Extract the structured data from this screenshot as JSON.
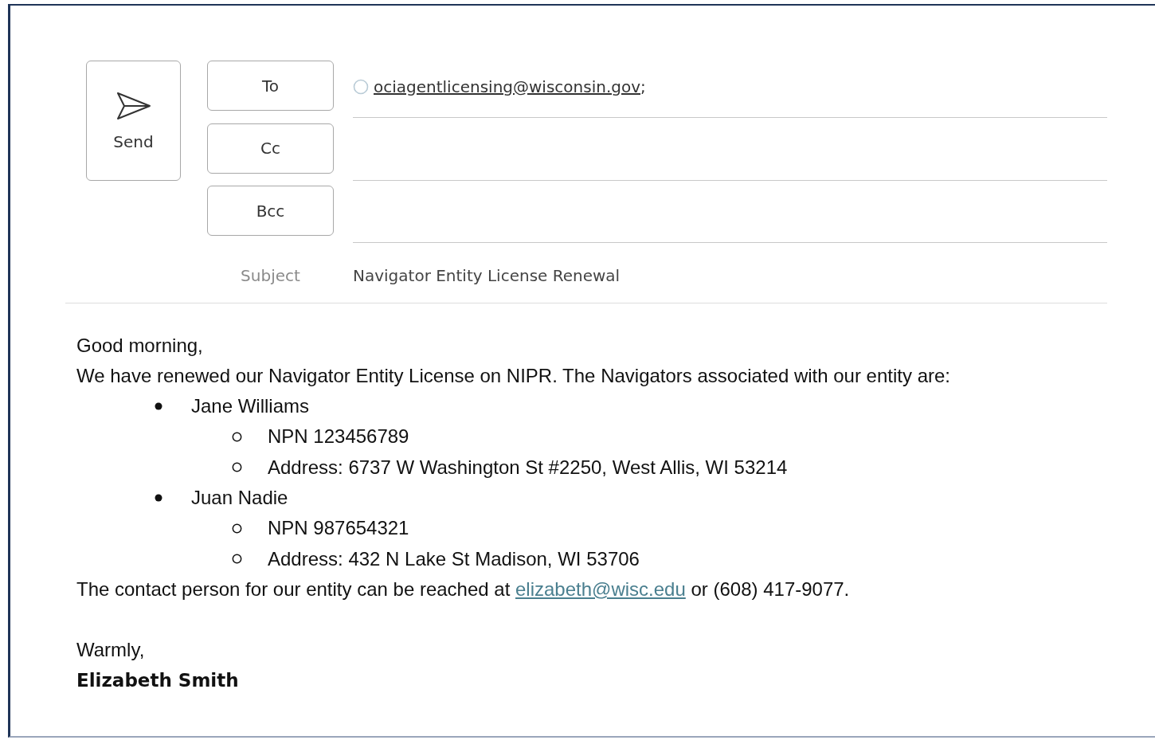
{
  "send_button": {
    "label": "Send"
  },
  "recipient_rows": [
    {
      "label": "To",
      "recipients": [
        {
          "address": "ociagentlicensing@wisconsin.gov",
          "separator": ";"
        }
      ]
    },
    {
      "label": "Cc"
    },
    {
      "label": "Bcc"
    }
  ],
  "subject": {
    "label": "Subject",
    "value": "Navigator Entity License Renewal"
  },
  "body": {
    "greeting": "Good morning,",
    "intro": "We have renewed our Navigator Entity License on NIPR. The Navigators associated with our entity are:",
    "navigators": [
      {
        "name": "Jane Williams",
        "details": [
          "NPN 123456789",
          "Address: 6737 W Washington St #2250, West Allis, WI 53214"
        ]
      },
      {
        "name": "Juan Nadie",
        "details": [
          "NPN 987654321",
          "Address: 432 N Lake St Madison, WI 53706"
        ]
      }
    ],
    "contact": {
      "before": "The contact person for our entity can be reached at",
      "link": "elizabeth@wisc.edu",
      "after": "or (608) 417-9077."
    },
    "closing": "Warmly,",
    "signature": "Elizabeth Smith"
  }
}
